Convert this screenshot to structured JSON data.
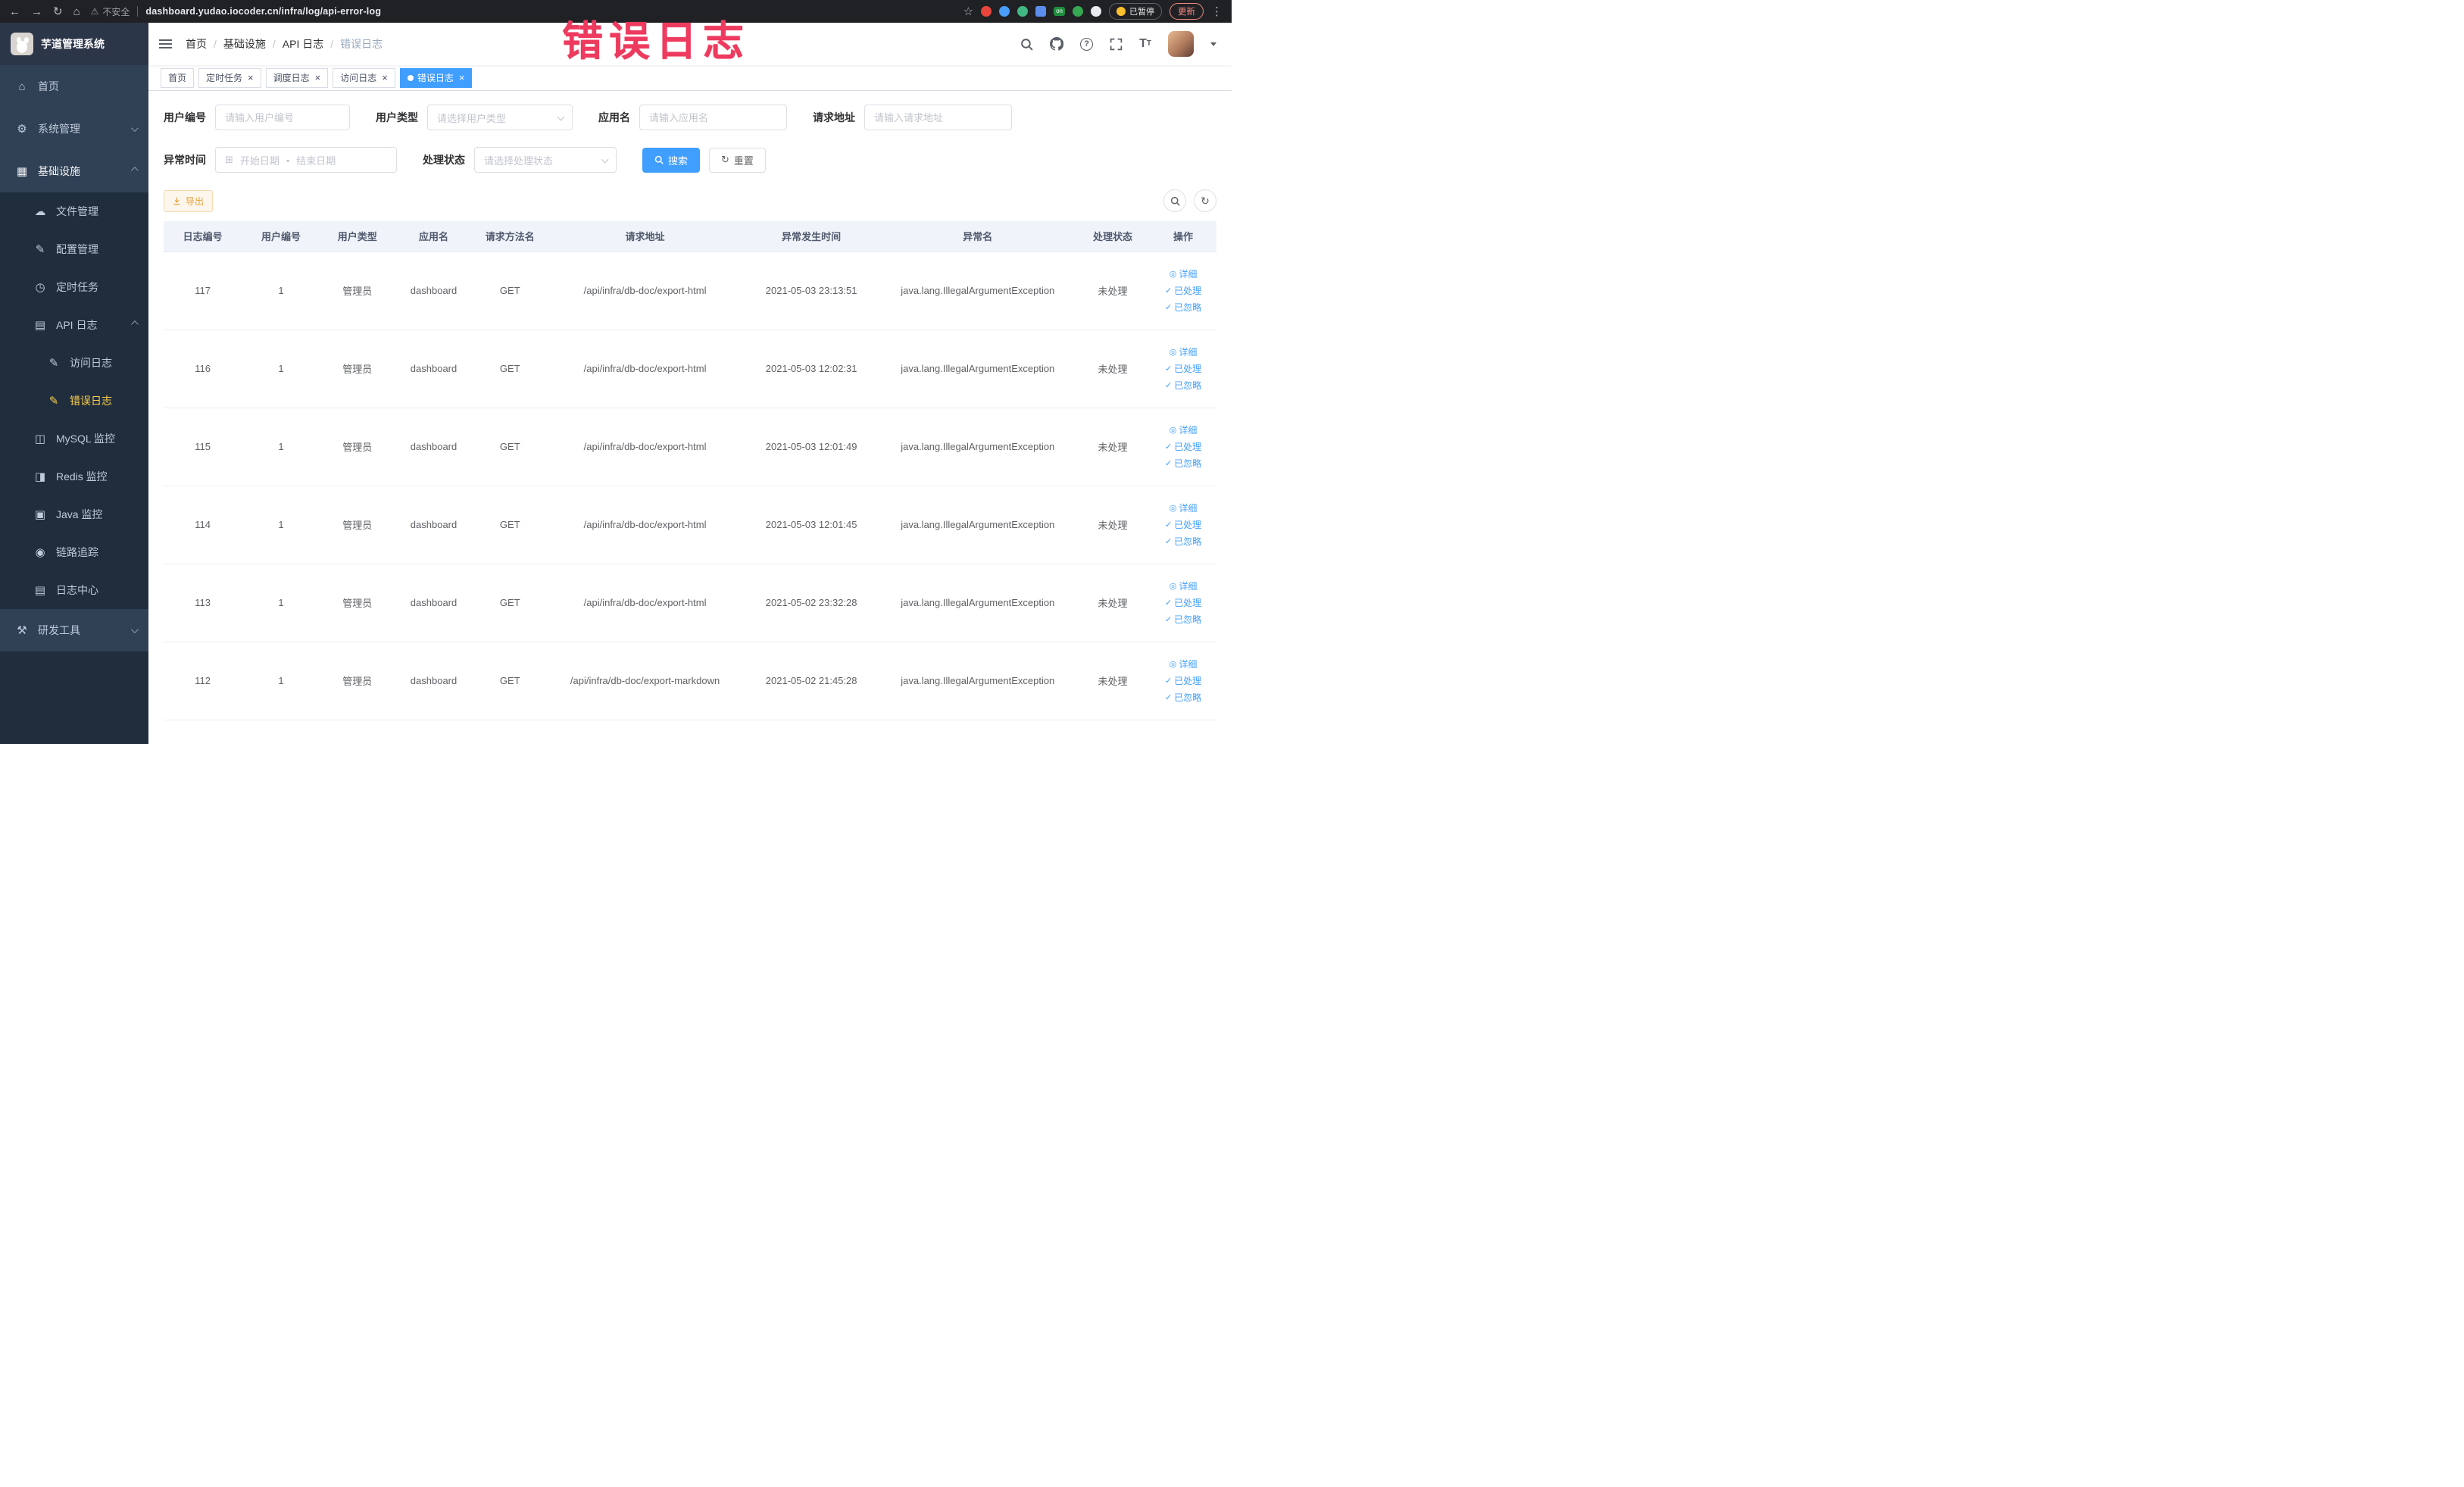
{
  "browser": {
    "security_label": "不安全",
    "url": "dashboard.yudao.iocoder.cn/infra/log/api-error-log",
    "ext_on": "on",
    "paused_badge": "已暂停",
    "update_label": "更新"
  },
  "annotation": {
    "text": "错误日志"
  },
  "sidebar": {
    "title": "芋道管理系统",
    "home": "首页",
    "system": "系统管理",
    "infra": "基础设施",
    "file": "文件管理",
    "config": "配置管理",
    "job": "定时任务",
    "api_log": "API 日志",
    "access_log": "访问日志",
    "error_log": "错误日志",
    "mysql": "MySQL 监控",
    "redis": "Redis 监控",
    "java": "Java 监控",
    "trace": "链路追踪",
    "log_center": "日志中心",
    "dev_tools": "研发工具"
  },
  "breadcrumb": {
    "items": [
      "首页",
      "基础设施",
      "API 日志",
      "错误日志"
    ]
  },
  "tabs": {
    "home": "首页",
    "job": "定时任务",
    "job_log": "调度日志",
    "access_log": "访问日志",
    "error_log": "错误日志"
  },
  "filters": {
    "user_id_label": "用户编号",
    "user_id_placeholder": "请输入用户编号",
    "user_type_label": "用户类型",
    "user_type_placeholder": "请选择用户类型",
    "app_name_label": "应用名",
    "app_name_placeholder": "请输入应用名",
    "request_url_label": "请求地址",
    "request_url_placeholder": "请输入请求地址",
    "exception_time_label": "异常时间",
    "date_start_placeholder": "开始日期",
    "date_separator": "-",
    "date_end_placeholder": "结束日期",
    "process_status_label": "处理状态",
    "process_status_placeholder": "请选择处理状态",
    "search_button": "搜索",
    "reset_button": "重置"
  },
  "toolbar": {
    "export_button": "导出"
  },
  "table": {
    "columns": [
      "日志编号",
      "用户编号",
      "用户类型",
      "应用名",
      "请求方法名",
      "请求地址",
      "异常发生时间",
      "异常名",
      "处理状态",
      "操作"
    ],
    "actions": {
      "detail": "详细",
      "processed": "已处理",
      "ignored": "已忽略"
    },
    "rows": [
      {
        "id": "117",
        "user_id": "1",
        "user_type": "管理员",
        "app": "dashboard",
        "method": "GET",
        "url": "/api/infra/db-doc/export-html",
        "time": "2021-05-03 23:13:51",
        "exception": "java.lang.IllegalArgumentException",
        "status": "未处理"
      },
      {
        "id": "116",
        "user_id": "1",
        "user_type": "管理员",
        "app": "dashboard",
        "method": "GET",
        "url": "/api/infra/db-doc/export-html",
        "time": "2021-05-03 12:02:31",
        "exception": "java.lang.IllegalArgumentException",
        "status": "未处理"
      },
      {
        "id": "115",
        "user_id": "1",
        "user_type": "管理员",
        "app": "dashboard",
        "method": "GET",
        "url": "/api/infra/db-doc/export-html",
        "time": "2021-05-03 12:01:49",
        "exception": "java.lang.IllegalArgumentException",
        "status": "未处理"
      },
      {
        "id": "114",
        "user_id": "1",
        "user_type": "管理员",
        "app": "dashboard",
        "method": "GET",
        "url": "/api/infra/db-doc/export-html",
        "time": "2021-05-03 12:01:45",
        "exception": "java.lang.IllegalArgumentException",
        "status": "未处理"
      },
      {
        "id": "113",
        "user_id": "1",
        "user_type": "管理员",
        "app": "dashboard",
        "method": "GET",
        "url": "/api/infra/db-doc/export-html",
        "time": "2021-05-02 23:32:28",
        "exception": "java.lang.IllegalArgumentException",
        "status": "未处理"
      },
      {
        "id": "112",
        "user_id": "1",
        "user_type": "管理员",
        "app": "dashboard",
        "method": "GET",
        "url": "/api/infra/db-doc/export-markdown",
        "time": "2021-05-02 21:45:28",
        "exception": "java.lang.IllegalArgumentException",
        "status": "未处理"
      }
    ]
  }
}
